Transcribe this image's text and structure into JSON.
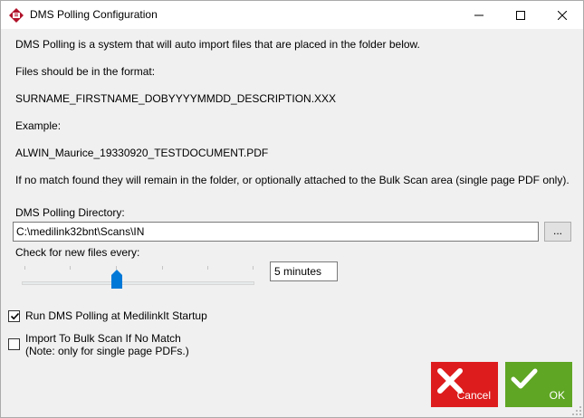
{
  "window": {
    "title": "DMS Polling Configuration"
  },
  "info": {
    "line1": "DMS Polling is a system that will auto import files that are placed in the folder below.",
    "line2": "Files should be in the format:",
    "format": "SURNAME_FIRSTNAME_DOBYYYYMMDD_DESCRIPTION.XXX",
    "example_label": "Example:",
    "example": "ALWIN_Maurice_19330920_TESTDOCUMENT.PDF",
    "nomatch": "If no match found they will remain in the folder, or optionally attached to the Bulk Scan area (single page PDF only)."
  },
  "directory": {
    "label": "DMS Polling Directory:",
    "value": "C:\\medilink32bnt\\Scans\\IN",
    "browse_label": "..."
  },
  "interval": {
    "label": "Check for new files every:",
    "value": "5 minutes",
    "slider_position_fraction": 0.41
  },
  "options": {
    "run_at_startup": {
      "label": "Run DMS Polling at MedilinkIt Startup",
      "checked": true
    },
    "import_bulk": {
      "label_line1": "Import To Bulk Scan If No Match",
      "label_line2": "(Note: only for single page PDFs.)",
      "checked": false
    }
  },
  "buttons": {
    "cancel": "Cancel",
    "ok": "OK"
  },
  "colors": {
    "cancel_bg": "#dd1d1d",
    "ok_bg": "#5fa624",
    "thumb": "#0078d7"
  }
}
